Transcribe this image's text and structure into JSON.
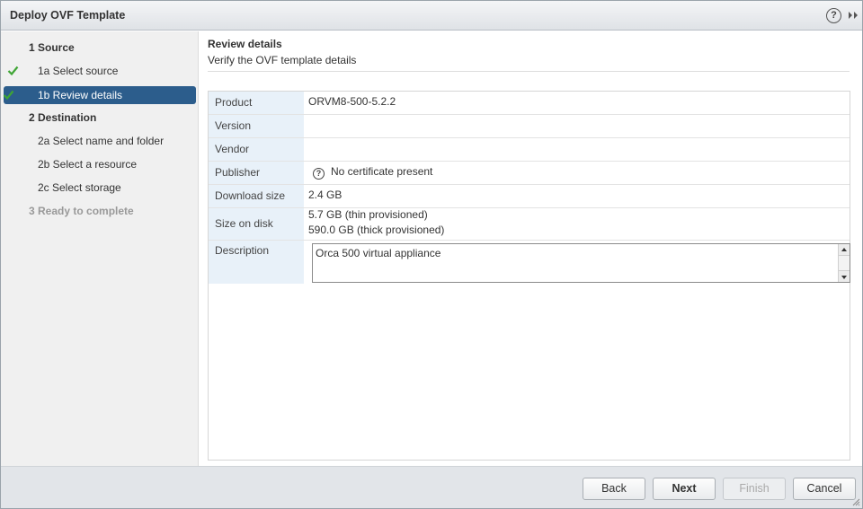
{
  "window": {
    "title": "Deploy OVF Template",
    "help_icon": "question-circle-icon",
    "expand_icon": "double-chevron-right-icon",
    "help_glyph": "?"
  },
  "colors": {
    "accent": "#2c5d8c",
    "check": "#3fa535",
    "key_bg": "#e8f1f9"
  },
  "sidebar": {
    "steps": [
      {
        "label": "1  Source",
        "type": "major",
        "checked": false,
        "active": false
      },
      {
        "label": "1a  Select source",
        "type": "minor",
        "checked": true,
        "active": false
      },
      {
        "label": "1b  Review details",
        "type": "minor",
        "checked": true,
        "active": true
      },
      {
        "label": "2  Destination",
        "type": "major",
        "checked": false,
        "active": false
      },
      {
        "label": "2a  Select name and folder",
        "type": "minor",
        "checked": false,
        "active": false
      },
      {
        "label": "2b  Select a resource",
        "type": "minor",
        "checked": false,
        "active": false
      },
      {
        "label": "2c  Select storage",
        "type": "minor",
        "checked": false,
        "active": false
      },
      {
        "label": "3  Ready to complete",
        "type": "major",
        "checked": false,
        "active": false,
        "disabled": true
      }
    ]
  },
  "main": {
    "title": "Review details",
    "subtitle": "Verify the OVF template details",
    "details": {
      "product": {
        "key": "Product",
        "value": "ORVM8-500-5.2.2"
      },
      "version": {
        "key": "Version",
        "value": ""
      },
      "vendor": {
        "key": "Vendor",
        "value": ""
      },
      "publisher": {
        "key": "Publisher",
        "value": "No certificate present",
        "icon": "question-circle-icon",
        "glyph": "?"
      },
      "download_size": {
        "key": "Download size",
        "value": "2.4 GB"
      },
      "size_on_disk": {
        "key": "Size on disk",
        "thin": "5.7 GB (thin provisioned)",
        "thick": "590.0 GB (thick provisioned)"
      },
      "description": {
        "key": "Description",
        "value": "Orca 500 virtual appliance"
      }
    }
  },
  "footer": {
    "back_label": "Back",
    "next_label": "Next",
    "finish_label": "Finish",
    "cancel_label": "Cancel"
  }
}
